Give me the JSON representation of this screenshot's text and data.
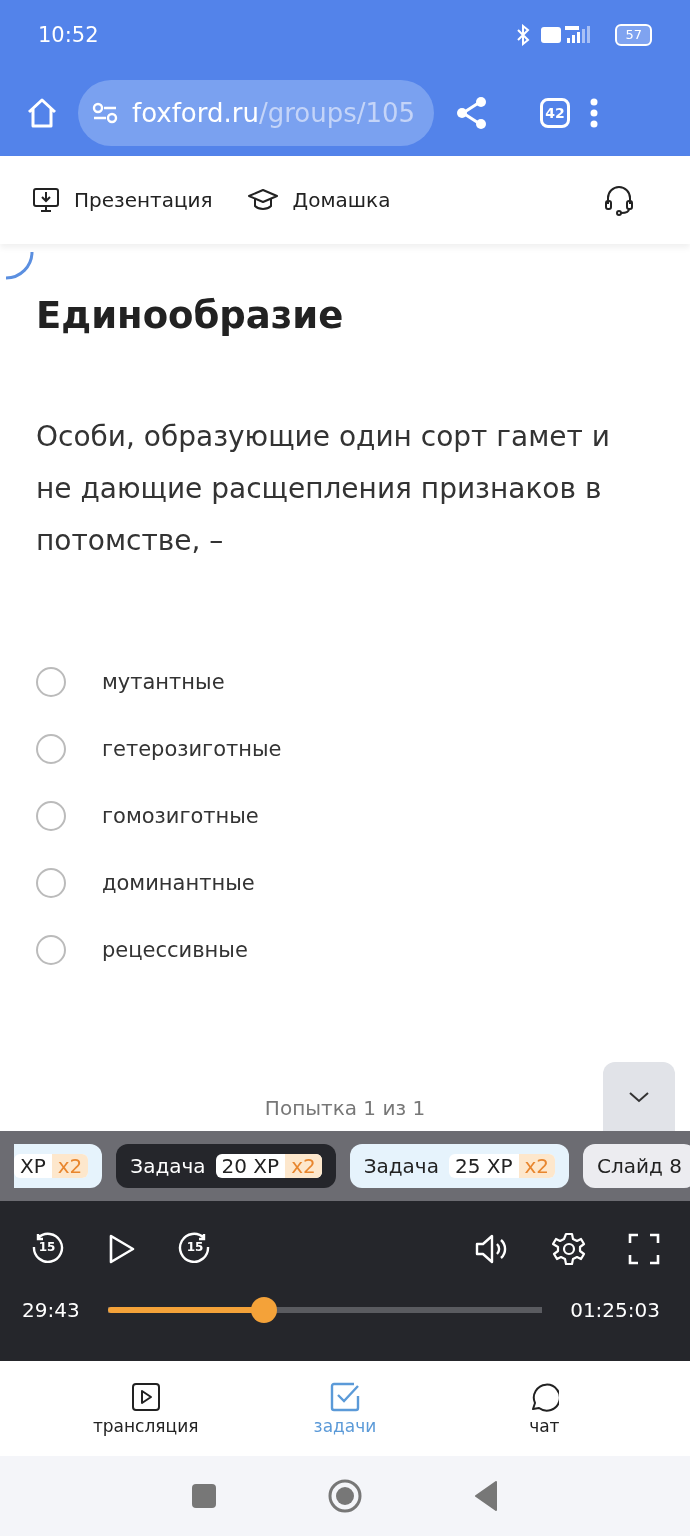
{
  "status_bar": {
    "time": "10:52",
    "battery": "57"
  },
  "browser": {
    "url_host": "foxford.ru",
    "url_path": "/groups/105",
    "tab_count": "42"
  },
  "toolbar": {
    "items": [
      {
        "kind": "presentation",
        "label": "Презентация"
      },
      {
        "kind": "homework",
        "label": "Домашка"
      }
    ]
  },
  "task": {
    "title": "Единообразие",
    "question": "Особи, образующие один сорт гамет и не дающие расщепления признаков в потомстве, –",
    "options": [
      {
        "label": "мутантные",
        "selected": false
      },
      {
        "label": "гетерозиготные",
        "selected": false
      },
      {
        "label": "гомозиготные",
        "selected": false
      },
      {
        "label": "доминантные",
        "selected": false
      },
      {
        "label": "рецессивные",
        "selected": false
      }
    ],
    "attempt": "Попытка 1 из 1"
  },
  "chips": [
    {
      "kind": "task",
      "xp": "XP",
      "multiplier": "x2",
      "selected": false
    },
    {
      "kind": "task",
      "label": "Задача",
      "xp": "20 XP",
      "multiplier": "x2",
      "selected": true
    },
    {
      "kind": "task",
      "label": "Задача",
      "xp": "25 XP",
      "multiplier": "x2",
      "selected": false
    },
    {
      "kind": "slide",
      "label": "Слайд 8",
      "selected": false
    }
  ],
  "player": {
    "elapsed": "29:43",
    "duration": "01:25:03",
    "level": 0.36,
    "rewind": "15",
    "forward": "15"
  },
  "bottom_nav": [
    {
      "kind": "stream",
      "label": "трансляция",
      "selected": false
    },
    {
      "kind": "tasks",
      "label": "задачи",
      "selected": true
    },
    {
      "kind": "chat",
      "label": "чат",
      "selected": false
    }
  ]
}
